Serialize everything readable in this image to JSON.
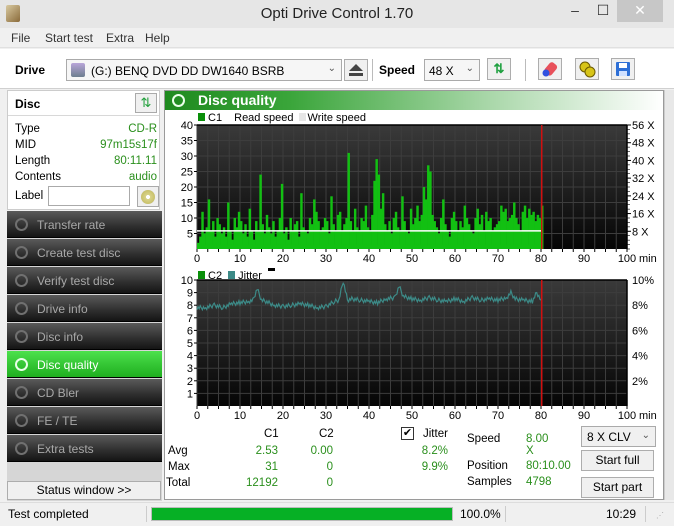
{
  "window": {
    "title": "Opti Drive Control 1.70",
    "minimize": "‒",
    "maximize": "☐",
    "close": "✕"
  },
  "menu": [
    "File",
    "Start test",
    "Extra",
    "Help"
  ],
  "toolbar": {
    "drive_label": "Drive",
    "drive_value": "(G:)  BENQ DVD DD DW1640 BSRB",
    "speed_label": "Speed",
    "speed_value": "48 X",
    "icons": [
      "eject-icon",
      "refresh-icon",
      "erase-icon",
      "settings-icon",
      "save-icon"
    ]
  },
  "disc": {
    "header": "Disc",
    "rows": [
      {
        "key": "Type",
        "value": "CD-R"
      },
      {
        "key": "MID",
        "value": "97m15s17f"
      },
      {
        "key": "Length",
        "value": "80:11.11"
      },
      {
        "key": "Contents",
        "value": "audio"
      }
    ],
    "label_key": "Label",
    "label_value": ""
  },
  "nav": {
    "items": [
      {
        "label": "Transfer rate",
        "active": false
      },
      {
        "label": "Create test disc",
        "active": false
      },
      {
        "label": "Verify test disc",
        "active": false
      },
      {
        "label": "Drive info",
        "active": false
      },
      {
        "label": "Disc info",
        "active": false
      },
      {
        "label": "Disc quality",
        "active": true
      },
      {
        "label": "CD Bler",
        "active": false
      },
      {
        "label": "FE / TE",
        "active": false
      },
      {
        "label": "Extra tests",
        "active": false
      }
    ],
    "status_window": "Status window >>"
  },
  "main": {
    "title": "Disc quality"
  },
  "chart_data": [
    {
      "type": "bar",
      "title": "C1",
      "legend": [
        {
          "name": "C1",
          "color": "#0a8f0a"
        },
        {
          "name": "Read speed",
          "color": "#ffffff"
        },
        {
          "name": "Write speed",
          "color": "#e6e6e6"
        }
      ],
      "xlabel": "min",
      "xlim": [
        0,
        100
      ],
      "x_ticks": [
        0,
        10,
        20,
        30,
        40,
        50,
        60,
        70,
        80,
        90,
        100
      ],
      "ylim": [
        0,
        40
      ],
      "y_ticks": [
        5,
        10,
        15,
        20,
        25,
        30,
        35,
        40
      ],
      "y2_ticks": [
        "8 X",
        "16 X",
        "24 X",
        "32 X",
        "40 X",
        "48 X",
        "56 X"
      ],
      "y2lim": [
        0,
        56
      ],
      "end_marker_min": 80.17,
      "grid": true,
      "series": [
        {
          "name": "C1",
          "color": "#12c012",
          "x": [
            0,
            0.5,
            1,
            1.5,
            2,
            2.5,
            3,
            3.5,
            4,
            4.5,
            5,
            5.5,
            6,
            6.5,
            7,
            7.5,
            8,
            8.5,
            9,
            9.5,
            10,
            10.5,
            11,
            11.5,
            12,
            12.5,
            13,
            13.5,
            14,
            14.5,
            15,
            15.5,
            16,
            16.5,
            17,
            17.5,
            18,
            18.5,
            19,
            19.5,
            20,
            20.5,
            21,
            21.5,
            22,
            22.5,
            23,
            23.5,
            24,
            24.5,
            25,
            25.5,
            26,
            26.5,
            27,
            27.5,
            28,
            28.5,
            29,
            29.5,
            30,
            30.5,
            31,
            31.5,
            32,
            32.5,
            33,
            33.5,
            34,
            34.5,
            35,
            35.5,
            36,
            36.5,
            37,
            37.5,
            38,
            38.5,
            39,
            39.5,
            40,
            40.5,
            41,
            41.5,
            42,
            42.5,
            43,
            43.5,
            44,
            44.5,
            45,
            45.5,
            46,
            46.5,
            47,
            47.5,
            48,
            48.5,
            49,
            49.5,
            50,
            50.5,
            51,
            51.5,
            52,
            52.5,
            53,
            53.5,
            54,
            54.5,
            55,
            55.5,
            56,
            56.5,
            57,
            57.5,
            58,
            58.5,
            59,
            59.5,
            60,
            60.5,
            61,
            61.5,
            62,
            62.5,
            63,
            63.5,
            64,
            64.5,
            65,
            65.5,
            66,
            66.5,
            67,
            67.5,
            68,
            68.5,
            69,
            69.5,
            70,
            70.5,
            71,
            71.5,
            72,
            72.5,
            73,
            73.5,
            74,
            74.5,
            75,
            75.5,
            76,
            76.5,
            77,
            77.5,
            78,
            78.5,
            79,
            79.5,
            80
          ],
          "values": [
            2,
            4,
            12,
            5,
            7,
            16,
            6,
            9,
            4,
            10,
            8,
            5,
            7,
            4,
            15,
            6,
            3,
            10,
            7,
            12,
            9,
            5,
            8,
            4,
            13,
            6,
            3,
            9,
            6,
            24,
            8,
            5,
            11,
            7,
            5,
            9,
            4,
            6,
            10,
            21,
            5,
            7,
            3,
            10,
            6,
            8,
            9,
            4,
            18,
            7,
            6,
            5,
            10,
            8,
            16,
            12,
            9,
            6,
            7,
            10,
            9,
            5,
            17,
            8,
            6,
            11,
            12,
            6,
            8,
            10,
            31,
            9,
            6,
            13,
            7,
            6,
            10,
            9,
            14,
            7,
            6,
            11,
            22,
            29,
            24,
            13,
            18,
            8,
            6,
            9,
            5,
            10,
            12,
            7,
            6,
            17,
            9,
            6,
            5,
            13,
            8,
            10,
            14,
            9,
            11,
            20,
            16,
            27,
            25,
            11,
            9,
            7,
            5,
            10,
            16,
            8,
            6,
            4,
            10,
            12,
            9,
            6,
            9,
            7,
            14,
            10,
            8,
            6,
            5,
            10,
            13,
            8,
            11,
            6,
            12,
            9,
            10,
            6,
            7,
            8,
            9,
            14,
            12,
            13,
            9,
            10,
            11,
            15,
            10,
            8,
            6,
            12,
            14,
            10,
            13,
            11,
            12,
            9,
            11,
            10,
            14,
            8
          ]
        },
        {
          "name": "Read speed",
          "color": "#ffffff",
          "unit": "X",
          "x": [
            0,
            80
          ],
          "values": [
            8.2,
            8.2
          ]
        }
      ]
    },
    {
      "type": "line",
      "title": "C2 / Jitter",
      "legend": [
        {
          "name": "C2",
          "color": "#0a8f0a"
        },
        {
          "name": "Jitter",
          "color": "#3c8a87"
        }
      ],
      "xlabel": "min",
      "xlim": [
        0,
        100
      ],
      "x_ticks": [
        0,
        10,
        20,
        30,
        40,
        50,
        60,
        70,
        80,
        90,
        100
      ],
      "ylim": [
        0,
        10
      ],
      "y_ticks": [
        1,
        2,
        3,
        4,
        5,
        6,
        7,
        8,
        9,
        10
      ],
      "y2lim": [
        0,
        10
      ],
      "y2_ticks": [
        "2%",
        "4%",
        "6%",
        "8%",
        "10%"
      ],
      "end_marker_min": 80.17,
      "grid": true,
      "series": [
        {
          "name": "Jitter",
          "color": "#3c8a87",
          "unit": "%",
          "x": [
            0,
            2,
            4,
            6,
            8,
            10,
            12,
            13,
            14,
            15,
            16,
            18,
            20,
            22,
            24,
            26,
            28,
            30,
            32,
            33,
            34,
            35,
            36,
            38,
            40,
            42,
            44,
            46,
            47,
            48,
            50,
            52,
            54,
            56,
            58,
            60,
            62,
            64,
            66,
            68,
            70,
            72,
            73,
            74,
            76,
            78,
            79,
            80
          ],
          "values": [
            7.8,
            7.8,
            8.0,
            7.8,
            8.1,
            8.2,
            8.3,
            8.4,
            9.3,
            8.4,
            8.3,
            8.0,
            7.9,
            8.0,
            8.1,
            8.0,
            7.8,
            7.9,
            8.3,
            8.4,
            9.9,
            8.4,
            8.5,
            8.4,
            8.3,
            8.2,
            8.5,
            8.6,
            9.5,
            8.7,
            8.5,
            8.4,
            8.6,
            8.4,
            8.3,
            8.5,
            8.3,
            8.6,
            8.4,
            8.5,
            8.4,
            8.6,
            9.0,
            8.5,
            8.4,
            8.3,
            9.0,
            8.4
          ]
        },
        {
          "name": "C2",
          "color": "#0a8f0a",
          "x": [
            0,
            80
          ],
          "values": [
            0,
            0
          ]
        }
      ]
    }
  ],
  "stats": {
    "col_c1": "C1",
    "col_c2": "C2",
    "jitter_label": "Jitter",
    "jitter_checked": true,
    "rows": [
      {
        "label": "Avg",
        "c1": "2.53",
        "c2": "0.00",
        "jitter": "8.2%"
      },
      {
        "label": "Max",
        "c1": "31",
        "c2": "0",
        "jitter": "9.9%"
      },
      {
        "label": "Total",
        "c1": "12192",
        "c2": "0",
        "jitter": ""
      }
    ],
    "speed_label": "Speed",
    "speed_value": "8.00 X",
    "position_label": "Position",
    "position_value": "80:10.00",
    "samples_label": "Samples",
    "samples_value": "4798",
    "clv_value": "8 X CLV",
    "start_full": "Start full",
    "start_part": "Start part"
  },
  "statusbar": {
    "message": "Test completed",
    "progress": 1.0,
    "progress_text": "100.0%",
    "time": "10:29"
  }
}
